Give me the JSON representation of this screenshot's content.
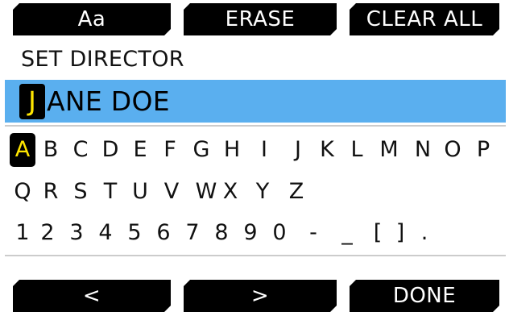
{
  "top_bar": {
    "case_label": "Aa",
    "erase_label": "ERASE",
    "clear_all_label": "CLEAR ALL"
  },
  "title": "SET DIRECTOR",
  "entry": {
    "cursor_char": "J",
    "rest_text": "ANE DOE"
  },
  "keyboard": {
    "row1": [
      "A",
      "B",
      "C",
      "D",
      "E",
      "F",
      "G",
      "H",
      "I",
      "J",
      "K",
      "L",
      "M",
      "N",
      "O",
      "P"
    ],
    "row2": [
      "Q",
      "R",
      "S",
      "T",
      "U",
      "V",
      "W",
      "X",
      "Y",
      "Z"
    ],
    "row3": [
      "1",
      "2",
      "3",
      "4",
      "5",
      "6",
      "7",
      "8",
      "9",
      "0",
      "-",
      "_",
      "[",
      "]",
      "."
    ],
    "selected_key": "A"
  },
  "bottom_bar": {
    "prev_label": "<",
    "next_label": ">",
    "done_label": "DONE"
  },
  "colors": {
    "accent_blue": "#5aafef",
    "highlight_yellow": "#ffe600",
    "button_black": "#000000"
  }
}
